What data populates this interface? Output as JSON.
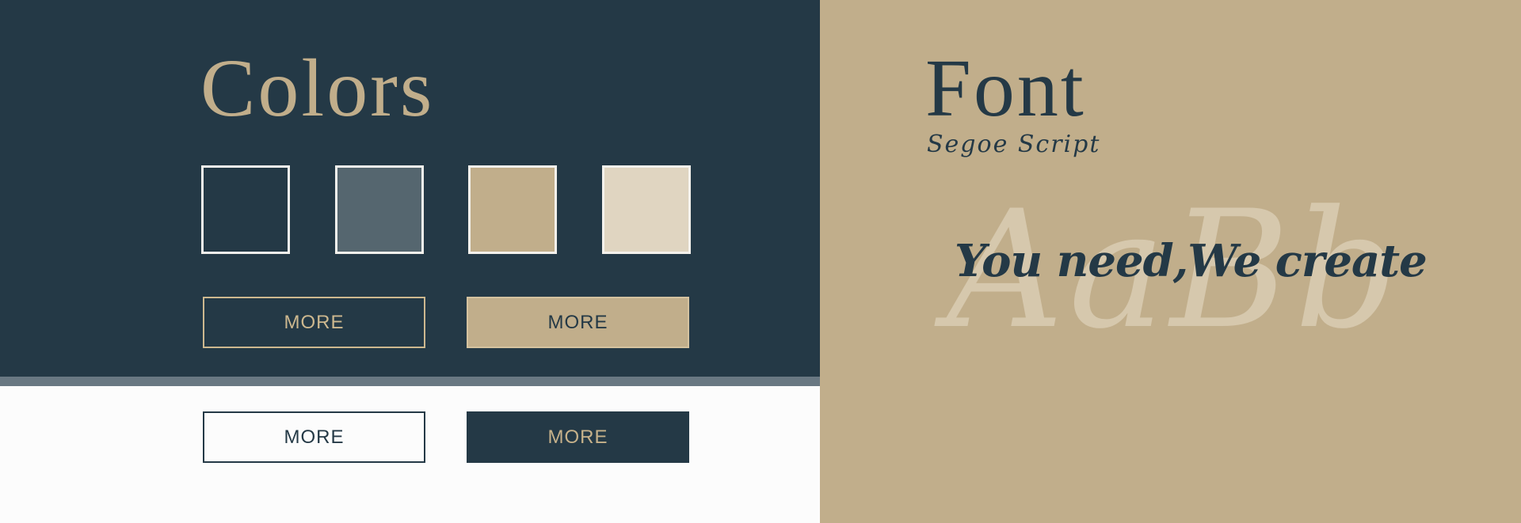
{
  "colors_section": {
    "title": "Colors",
    "swatches": [
      {
        "name": "navy",
        "color": "#243946"
      },
      {
        "name": "slate",
        "color": "#55666f"
      },
      {
        "name": "sand",
        "color": "#c1ae8b"
      },
      {
        "name": "cream",
        "color": "#e0d5c1"
      }
    ],
    "buttons": [
      {
        "label": "MORE",
        "variant": "outline-sand-on-navy"
      },
      {
        "label": "MORE",
        "variant": "filled-sand"
      },
      {
        "label": "MORE",
        "variant": "outline-navy-on-white"
      },
      {
        "label": "MORE",
        "variant": "filled-navy"
      }
    ]
  },
  "font_section": {
    "title": "Font",
    "font_name": "Segoe Script",
    "sample_glyphs": "AaBb",
    "tagline": "You need,We create"
  },
  "palette": {
    "navy": "#243946",
    "slate": "#697882",
    "sand": "#c1ae8b",
    "light": "#fcfcfc"
  }
}
